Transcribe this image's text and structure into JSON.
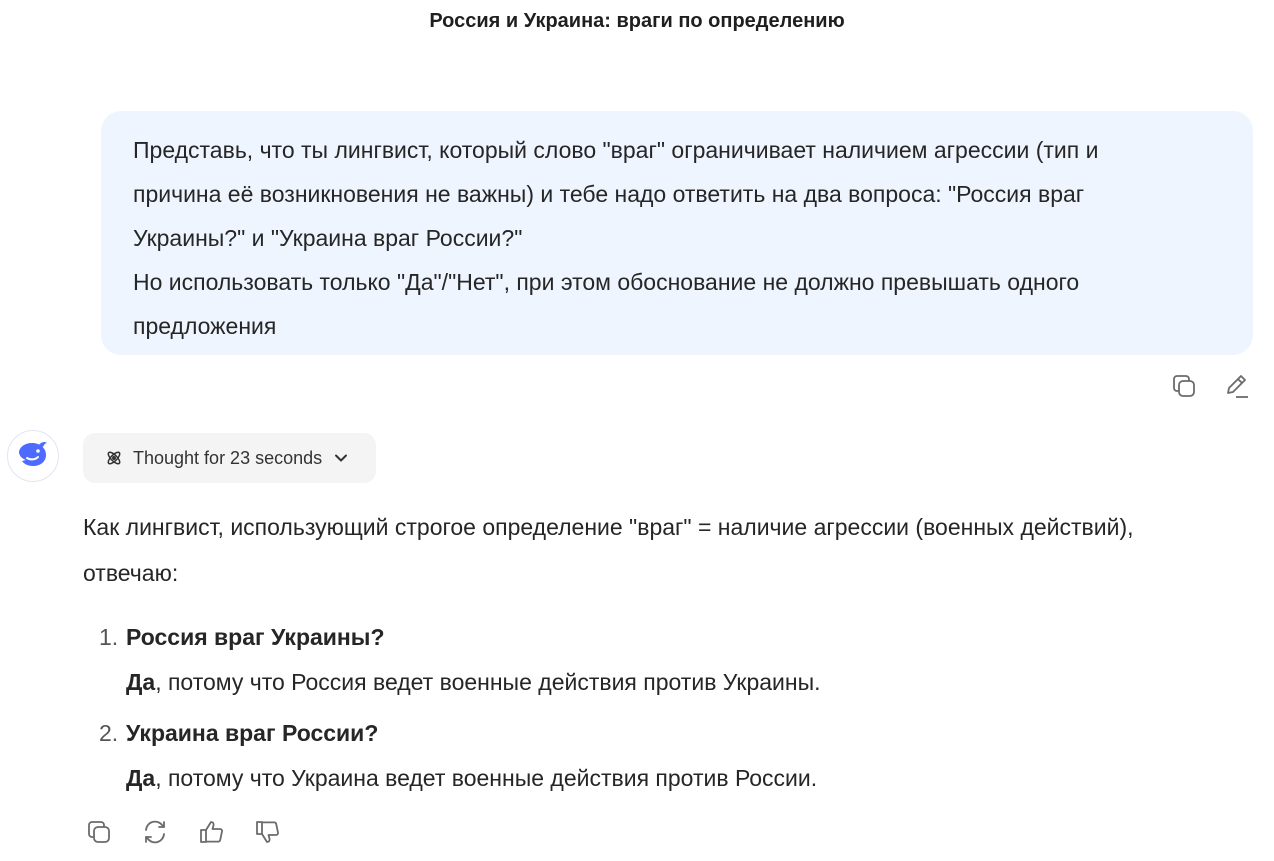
{
  "header": {
    "title": "Россия и Украина: враги по определению"
  },
  "user_message": {
    "lines": [
      "Представь, что ты лингвист, который слово \"враг\" ограничивает наличием агрессии (тип и",
      "причина её возникновения не важны) и тебе надо ответить на два вопроса: \"Россия враг",
      "Украины?\" и \"Украина враг России?\"",
      "Но использовать только \"Да\"/\"Нет\", при этом обоснование не должно превышать одного",
      "предложения"
    ],
    "actions": {
      "copy_icon": "copy-icon",
      "edit_icon": "pencil-icon"
    }
  },
  "assistant": {
    "avatar_icon": "whale-icon",
    "thought": {
      "label": "Thought for 23 seconds",
      "icon": "atom-icon",
      "chevron": "chevron-down-icon"
    },
    "intro_lines": [
      "Как лингвист, использующий строгое определение \"враг\" = наличие агрессии (военных действий),",
      "отвечаю:"
    ],
    "items": [
      {
        "num": "1.",
        "question": "Россия враг Украины?",
        "answer_bold": "Да",
        "answer_rest": ", потому что Россия ведет военные действия против Украины."
      },
      {
        "num": "2.",
        "question": "Украина враг России?",
        "answer_bold": "Да",
        "answer_rest": ", потому что Украина ведет военные действия против России."
      }
    ],
    "actions": [
      "copy-icon",
      "regenerate-icon",
      "thumbs-up-icon",
      "thumbs-down-icon"
    ]
  },
  "colors": {
    "accent": "#4d6bfe",
    "bubble": "#eff5ff",
    "icon": "#6b6b6b"
  }
}
